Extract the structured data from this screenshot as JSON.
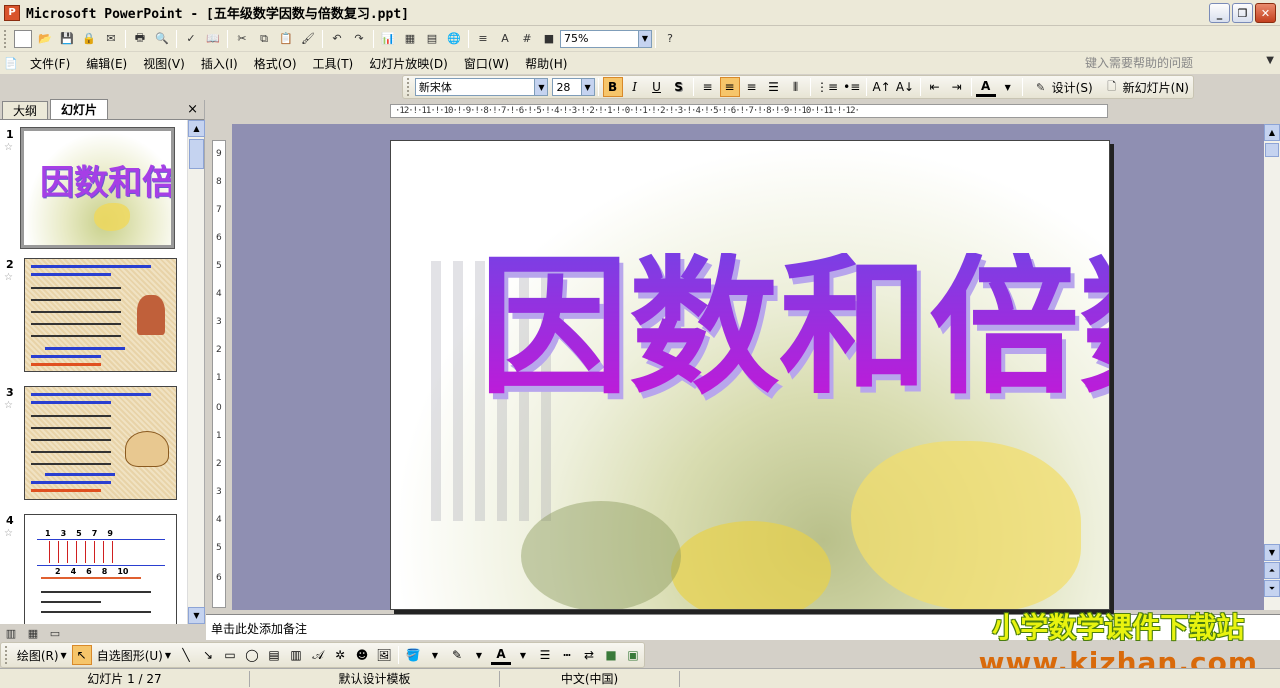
{
  "window": {
    "title": "Microsoft PowerPoint - [五年级数学因数与倍数复习.ppt]",
    "controls": {
      "minimize": "_",
      "maximize": "❐",
      "close": "✕"
    }
  },
  "standard_toolbar": {
    "zoom": "75%"
  },
  "menu": {
    "items": [
      "文件(F)",
      "编辑(E)",
      "视图(V)",
      "插入(I)",
      "格式(O)",
      "工具(T)",
      "幻灯片放映(D)",
      "窗口(W)",
      "帮助(H)"
    ],
    "help_placeholder": "键入需要帮助的问题"
  },
  "format_toolbar": {
    "font": "新宋体",
    "size": "28",
    "bold": "B",
    "italic": "I",
    "underline": "U",
    "shadow": "S",
    "design": "设计(S)",
    "new_slide": "新幻灯片(N)"
  },
  "left_pane": {
    "tab_outline": "大纲",
    "tab_slides": "幻灯片",
    "close": "×",
    "thumbnails": [
      {
        "num": "1",
        "title": "因数和倍数"
      },
      {
        "num": "2"
      },
      {
        "num": "3"
      },
      {
        "num": "4",
        "digits_top": [
          "1",
          "3",
          "5",
          "7",
          "9"
        ],
        "digits_bottom": [
          "2",
          "4",
          "6",
          "8",
          "10"
        ]
      }
    ]
  },
  "ruler": {
    "h_ticks": "·12·!·11·!·10·!·9·!·8·!·7·!·6·!·5·!·4·!·3·!·2·!·1·!·0·!·1·!·2·!·3·!·4·!·5·!·6·!·7·!·8·!·9·!·10·!·11·!·12·",
    "v_ticks": [
      "9",
      "8",
      "7",
      "6",
      "5",
      "4",
      "3",
      "2",
      "1",
      "0",
      "1",
      "2",
      "3",
      "4",
      "5",
      "6"
    ]
  },
  "slide": {
    "title": "因数和倍数"
  },
  "notes": {
    "placeholder": "单击此处添加备注"
  },
  "drawing_toolbar": {
    "draw": "绘图(R)",
    "autoshapes": "自选图形(U)"
  },
  "status": {
    "slide_counter": "幻灯片 1 / 27",
    "template": "默认设计模板",
    "language": "中文(中国)"
  },
  "watermark": {
    "line1": "小学数学课件下载站",
    "line2": "www.kjzhan.com"
  },
  "colors": {
    "title_gradient_top": "#7b3fe4",
    "title_gradient_bottom": "#c01ad8",
    "workspace": "#8f8fb2"
  }
}
